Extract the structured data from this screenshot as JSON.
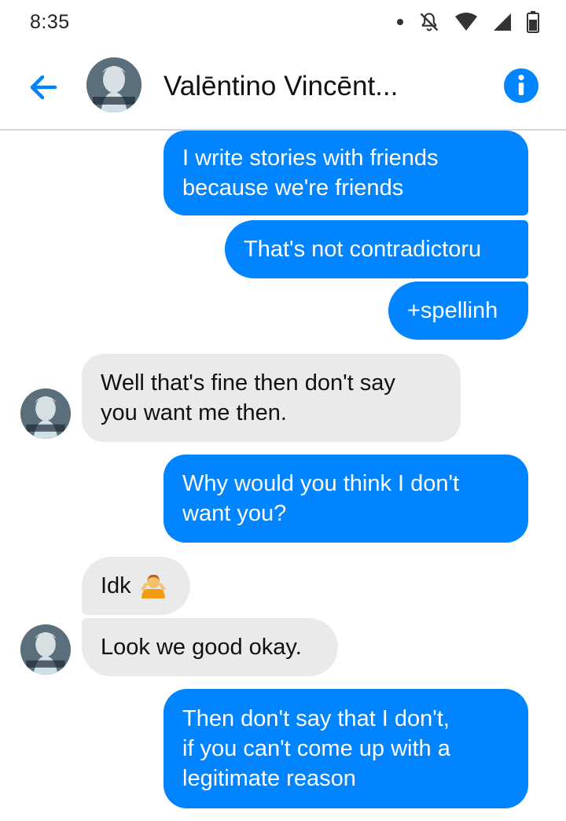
{
  "status": {
    "time": "8:35",
    "icons": [
      "dot-icon",
      "notifications-off-icon",
      "wifi-icon",
      "signal-icon",
      "battery-icon"
    ]
  },
  "header": {
    "title": "Valēntino Vincēnt...",
    "back_icon": "back-arrow-icon",
    "info_icon": "info-icon",
    "accent": "#0084ff"
  },
  "colors": {
    "sent_bubble": "#0084ff",
    "received_bubble": "#eaeaea"
  },
  "messages": [
    {
      "side": "sent",
      "lines": [
        "I write stories with friends",
        "because we're friends"
      ]
    },
    {
      "side": "sent",
      "lines": [
        "That's not contradictoru"
      ]
    },
    {
      "side": "sent",
      "lines": [
        "+spellinh"
      ]
    },
    {
      "side": "received",
      "lines": [
        "Well that's fine then don't say",
        "you want me then."
      ]
    },
    {
      "side": "sent",
      "lines": [
        "Why would you think I don't",
        "want you?"
      ]
    },
    {
      "side": "received",
      "lines": [
        "Idk"
      ],
      "emoji": "shrug-emoji"
    },
    {
      "side": "received",
      "lines": [
        "Look we good okay."
      ]
    },
    {
      "side": "sent",
      "lines": [
        "Then don't say that I don't,",
        "if you can't come up with a",
        "legitimate reason"
      ]
    }
  ]
}
